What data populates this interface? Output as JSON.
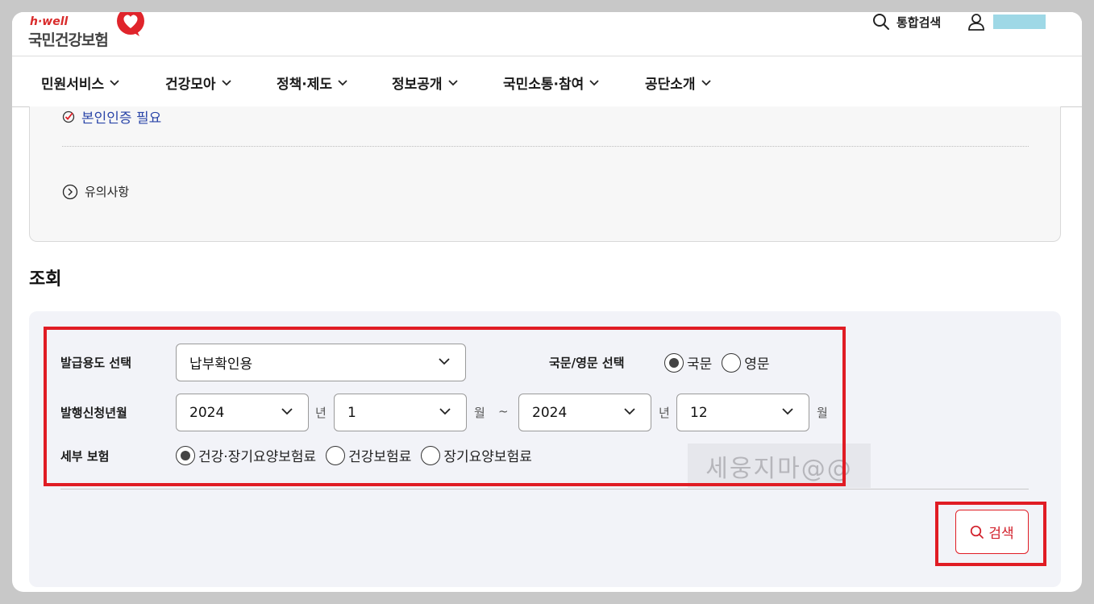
{
  "header": {
    "logo_tagline": "h·well",
    "logo_name": "국민건강보험",
    "search_label": "통합검색"
  },
  "nav": {
    "items": [
      {
        "label": "민원서비스"
      },
      {
        "label": "건강모아"
      },
      {
        "label": "정책·제도"
      },
      {
        "label": "정보공개"
      },
      {
        "label": "국민소통·참여"
      },
      {
        "label": "공단소개"
      }
    ]
  },
  "info": {
    "auth_required": "본인인증 필요",
    "notice": "유의사항"
  },
  "section_title": "조회",
  "form": {
    "purpose_label": "발급용도 선택",
    "purpose_value": "납부확인용",
    "language_label": "국문/영문 선택",
    "language_options": [
      {
        "label": "국문",
        "selected": true
      },
      {
        "label": "영문",
        "selected": false
      }
    ],
    "period_label": "발행신청년월",
    "start_year": "2024",
    "start_month": "1",
    "end_year": "2024",
    "end_month": "12",
    "year_unit": "년",
    "month_unit": "월",
    "range_sep": "~",
    "insurance_label": "세부 보험",
    "insurance_options": [
      {
        "label": "건강·장기요양보험료",
        "selected": true
      },
      {
        "label": "건강보험료",
        "selected": false
      },
      {
        "label": "장기요양보험료",
        "selected": false
      }
    ],
    "search_button": "검색"
  },
  "watermark": "세웅지마@@",
  "colors": {
    "accent_red": "#e01c24",
    "link_blue": "#2a45a8",
    "panel_bg": "#f2f3f8"
  }
}
